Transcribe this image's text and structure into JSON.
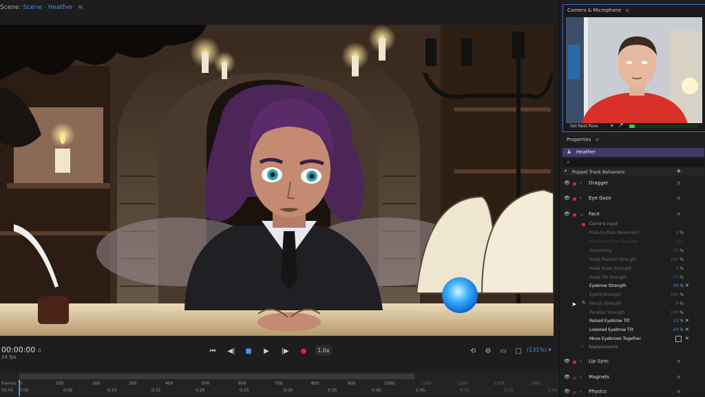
{
  "scene": {
    "prefix": "Scene:",
    "name": "Scene - Heather",
    "menu_icon": "hamburger-icon"
  },
  "transport": {
    "time": "00:00:00",
    "time_suffix": "0",
    "fps": "24 fps",
    "speed": "1.0x",
    "zoom": "(131%)"
  },
  "timeline": {
    "frames_label": "frames",
    "time_label": "00:00",
    "frame_ticks": [
      "0",
      "100",
      "200",
      "300",
      "400",
      "500",
      "600",
      "700",
      "800",
      "900",
      "1000",
      "1100",
      "1200",
      "1300",
      "1400"
    ],
    "time_ticks": [
      "0:00",
      "0:05",
      "0:10",
      "0:15",
      "0:20",
      "0:25",
      "0:30",
      "0:35",
      "0:40",
      "0:45",
      "0:50",
      "0:55",
      "1:00"
    ]
  },
  "camera": {
    "title": "Camera & Microphone",
    "rest_pose": "Set Rest Pose",
    "mic_level": 0.08
  },
  "properties": {
    "title": "Properties",
    "puppet": "Heather",
    "section": "Puppet Track Behaviors",
    "behaviors": [
      {
        "name": "Dragger"
      },
      {
        "name": "Eye Gaze"
      },
      {
        "name": "Face"
      }
    ],
    "camera_input": "Camera Input",
    "params": [
      {
        "name": "Pose-to-Pose Movement",
        "value": "0",
        "unit": "%"
      },
      {
        "name": "Minimum Pose Duration",
        "value": "1 fps",
        "unit": ""
      },
      {
        "name": "Smoothing",
        "value": "15",
        "unit": "%"
      },
      {
        "name": "Head Position Strength",
        "value": "100",
        "unit": "%"
      },
      {
        "name": "Head Scale Strength",
        "value": "0",
        "unit": "%"
      },
      {
        "name": "Head Tilt Strength",
        "value": "75",
        "unit": "%"
      },
      {
        "name": "Eyebrow Strength",
        "value": "50",
        "unit": "%"
      },
      {
        "name": "Eyelid Strength",
        "value": "100",
        "unit": "%"
      },
      {
        "name": "Mouth Strength",
        "value": "0",
        "unit": "%"
      },
      {
        "name": "Parallax Strength",
        "value": "100",
        "unit": "%"
      },
      {
        "name": "Raised Eyebrow Tilt",
        "value": "15",
        "unit": "%"
      },
      {
        "name": "Lowered Eyebrow Tilt",
        "value": "-24",
        "unit": "%"
      },
      {
        "name": "Move Eyebrows Together",
        "value": "",
        "unit": ""
      }
    ],
    "replacements": "Replacements",
    "behaviors_bottom": [
      {
        "name": "Lip Sync"
      },
      {
        "name": "Magnets"
      },
      {
        "name": "Physics"
      }
    ]
  },
  "colors": {
    "accent_blue": "#4b8df8",
    "record_red": "#e02828",
    "puppet_row": "#3e3a68",
    "meter_green": "#2fd04b"
  }
}
